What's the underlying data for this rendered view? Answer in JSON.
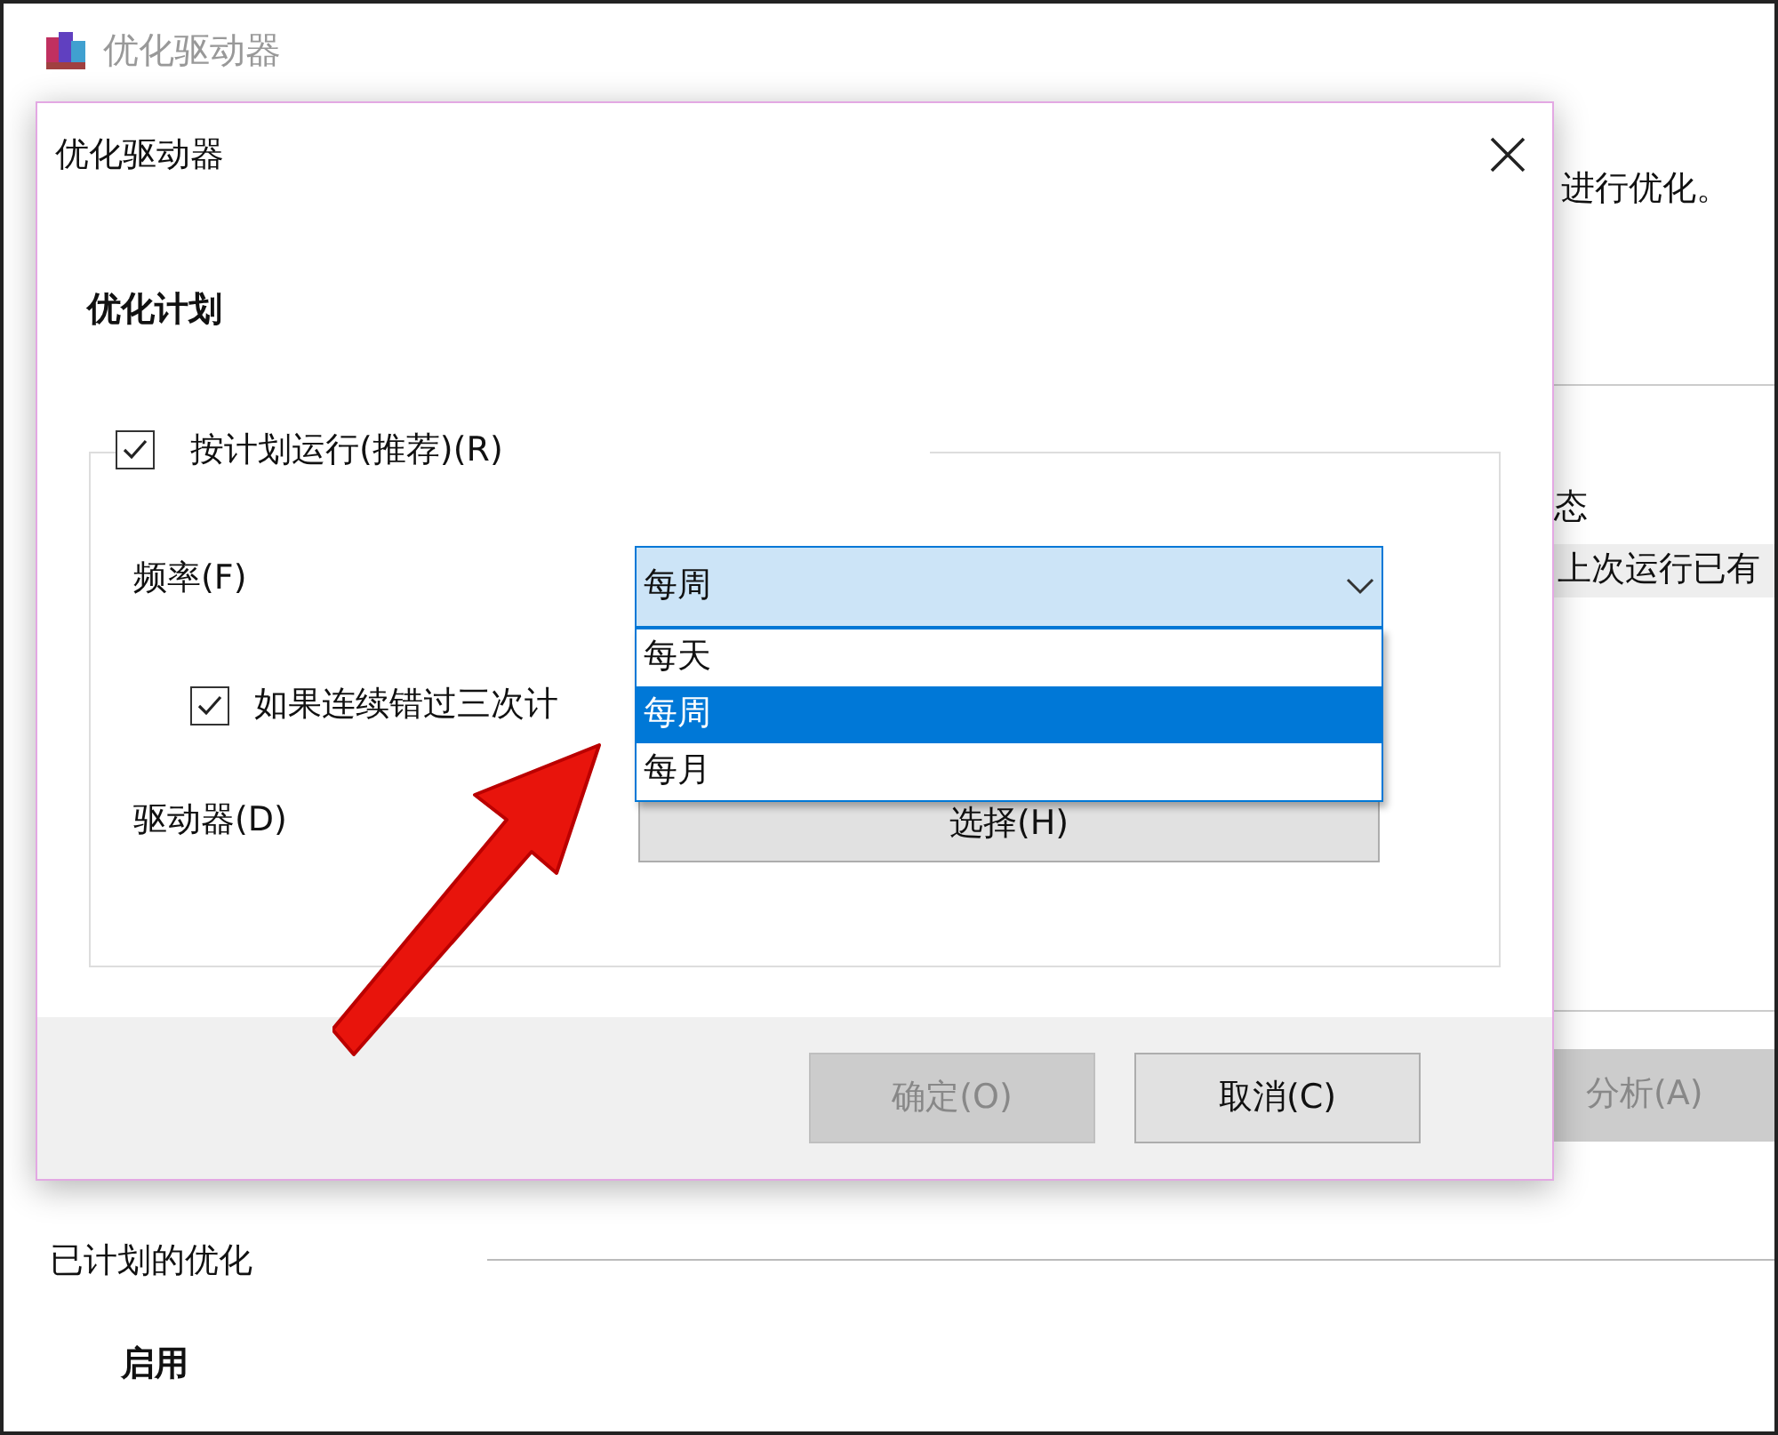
{
  "window": {
    "title": "优化驱动器",
    "text_fragment": "进行优化。",
    "column_fragment": "态",
    "row_fragment": "上次运行已有",
    "analyze_button": {
      "label": "分析(A)",
      "disabled": true
    },
    "scheduled_section": "已计划的优化",
    "enabled_label": "启用"
  },
  "dialog": {
    "title": "优化驱动器",
    "section": "优化计划",
    "schedule_checkbox": {
      "label": "按计划运行(推荐)(R)",
      "checked": true
    },
    "frequency": {
      "label": "频率(F)",
      "value": "每周",
      "expanded": true,
      "options": [
        {
          "label": "每天",
          "selected": false
        },
        {
          "label": "每周",
          "selected": true
        },
        {
          "label": "每月",
          "selected": false
        }
      ]
    },
    "missed_checkbox": {
      "label": "如果连续错过三次计",
      "checked": true
    },
    "drives": {
      "label": "驱动器(D)",
      "button": "选择(H)"
    },
    "buttons": [
      {
        "label": "确定(O)",
        "disabled": true
      },
      {
        "label": "取消(C)",
        "disabled": false
      }
    ]
  }
}
